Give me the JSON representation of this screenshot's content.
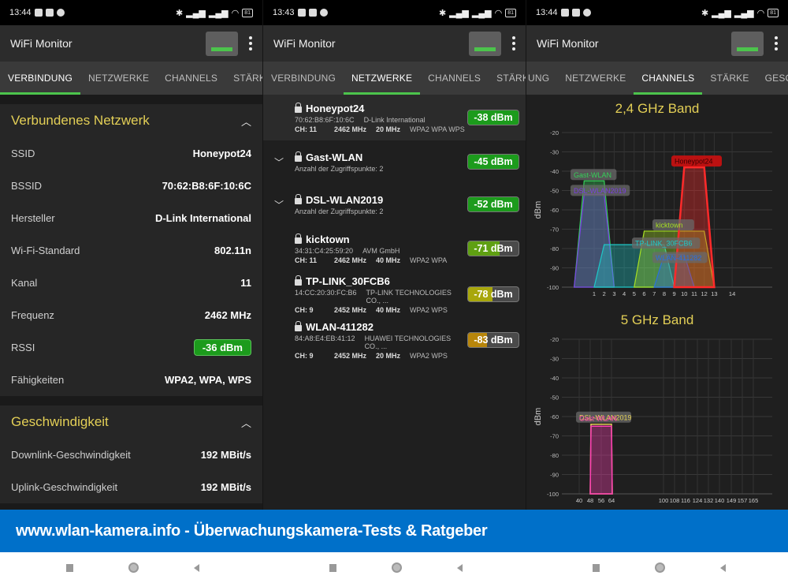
{
  "app": {
    "title": "WiFi Monitor"
  },
  "screens": [
    {
      "time": "13:44",
      "battery": "81",
      "tabs": [
        "VERBINDUNG",
        "NETZWERKE",
        "CHANNELS",
        "STÄRKE"
      ],
      "active_tab": 0
    },
    {
      "time": "13:43",
      "battery": "81",
      "tabs": [
        "VERBINDUNG",
        "NETZWERKE",
        "CHANNELS",
        "STÄRKE"
      ],
      "active_tab": 1
    },
    {
      "time": "13:44",
      "battery": "81",
      "tabs": [
        "UNG",
        "NETZWERKE",
        "CHANNELS",
        "STÄRKE",
        "GESCHW"
      ],
      "active_tab": 2
    }
  ],
  "connection": {
    "section_title": "Verbundenes Netzwerk",
    "rows": [
      {
        "label": "SSID",
        "value": "Honeypot24"
      },
      {
        "label": "BSSID",
        "value": "70:62:B8:6F:10:6C"
      },
      {
        "label": "Hersteller",
        "value": "D-Link International"
      },
      {
        "label": "Wi-Fi-Standard",
        "value": "802.11n"
      },
      {
        "label": "Kanal",
        "value": "11"
      },
      {
        "label": "Frequenz",
        "value": "2462 MHz"
      },
      {
        "label": "RSSI",
        "value": "-36 dBm"
      },
      {
        "label": "Fähigkeiten",
        "value": "WPA2, WPA, WPS"
      }
    ],
    "speed_title": "Geschwindigkeit",
    "speed_rows": [
      {
        "label": "Downlink-Geschwindigkeit",
        "value": "192 MBit/s"
      },
      {
        "label": "Uplink-Geschwindigkeit",
        "value": "192 MBit/s"
      }
    ]
  },
  "networks": [
    {
      "ssid": "Honeypot24",
      "bssid": "70:62:B8:6F:10:6C",
      "vendor": "D-Link International",
      "channel": "CH: 11",
      "freq": "2462 MHz",
      "width": "20 MHz",
      "security": "WPA2 WPA WPS",
      "rssi": "-38 dBm",
      "strength": 1.0,
      "color": "#1c9b1c",
      "expandable": false
    },
    {
      "ssid": "Gast-WLAN",
      "sub": "Anzahl der Zugriffspunkte: 2",
      "rssi": "-45 dBm",
      "strength": 1.0,
      "color": "#1c9b1c",
      "expandable": true
    },
    {
      "ssid": "DSL-WLAN2019",
      "sub": "Anzahl der Zugriffspunkte: 2",
      "rssi": "-52 dBm",
      "strength": 1.0,
      "color": "#1c9b1c",
      "expandable": true
    },
    {
      "ssid": "kicktown",
      "bssid": "34:31:C4:25:59:20",
      "vendor": "AVM GmbH",
      "channel": "CH: 11",
      "freq": "2462 MHz",
      "width": "40 MHz",
      "security": "WPA2 WPA",
      "rssi": "-71 dBm",
      "strength": 0.62,
      "color": "#5fa012",
      "expandable": false
    },
    {
      "ssid": "TP-LINK_30FCB6",
      "bssid": "14:CC:20:30:FC:B6",
      "vendor": "TP-LINK TECHNOLOGIES CO., ...",
      "channel": "CH: 9",
      "freq": "2452 MHz",
      "width": "40 MHz",
      "security": "WPA2 WPS",
      "rssi": "-78 dBm",
      "strength": 0.48,
      "color": "#a8a70c",
      "expandable": false
    },
    {
      "ssid": "WLAN-411282",
      "bssid": "84:A8:E4:EB:41:12",
      "vendor": "HUAWEI TECHNOLOGIES CO., ...",
      "channel": "CH: 9",
      "freq": "2452 MHz",
      "width": "20 MHz",
      "security": "WPA2 WPS",
      "rssi": "-83 dBm",
      "strength": 0.38,
      "color": "#b8860b",
      "expandable": false
    }
  ],
  "chart_data": [
    {
      "type": "area",
      "title": "2,4 GHz Band",
      "ylabel": "dBm",
      "xlabel": "",
      "ylim": [
        -100,
        -20
      ],
      "yticks": [
        -20,
        -30,
        -40,
        -50,
        -60,
        -70,
        -80,
        -90,
        -100
      ],
      "xlim": [
        -2,
        16
      ],
      "xticks": [
        1,
        2,
        3,
        4,
        5,
        6,
        7,
        8,
        9,
        10,
        11,
        12,
        13,
        14
      ],
      "grid": true,
      "series": [
        {
          "name": "Gast-WLAN",
          "channel": 1,
          "span": 2,
          "dBm": -45,
          "color": "#34d058"
        },
        {
          "name": "DSL-WLAN2019",
          "channel": 1,
          "span": 2,
          "dBm": -52,
          "color": "#7b3fe4"
        },
        {
          "name": "TP-LINK_30FCB6",
          "channel": 5,
          "span": 4,
          "dBm": -78,
          "color": "#1ec8c8"
        },
        {
          "name": "kicktown",
          "channel": 9,
          "span": 4,
          "dBm": -71,
          "color": "#a7e022"
        },
        {
          "name": "WLAN-411282",
          "channel": 9,
          "span": 2,
          "dBm": -83,
          "color": "#2b6fe0"
        },
        {
          "name": "Honeypot24",
          "channel": 11,
          "span": 2,
          "dBm": -38,
          "color": "#ff2a2a"
        }
      ]
    },
    {
      "type": "area",
      "title": "5 GHz Band",
      "ylabel": "dBm",
      "xlabel": "",
      "ylim": [
        -100,
        -20
      ],
      "yticks": [
        -20,
        -30,
        -40,
        -50,
        -60,
        -70,
        -80,
        -90,
        -100
      ],
      "xticks": [
        "40",
        "48",
        "56",
        "64",
        "100",
        "108",
        "116",
        "124",
        "132",
        "140",
        "149",
        "157",
        "165"
      ],
      "grid": true,
      "series": [
        {
          "name": "DSL-WLAN2019",
          "channel": 56,
          "dBm": -64,
          "color": "#e3cf56"
        },
        {
          "name": "Gast-WLAN",
          "channel": 56,
          "dBm": -65,
          "color": "#ff3fb4"
        }
      ]
    }
  ],
  "banner": "www.wlan-kamera.info - Überwachungskamera-Tests & Ratgeber"
}
